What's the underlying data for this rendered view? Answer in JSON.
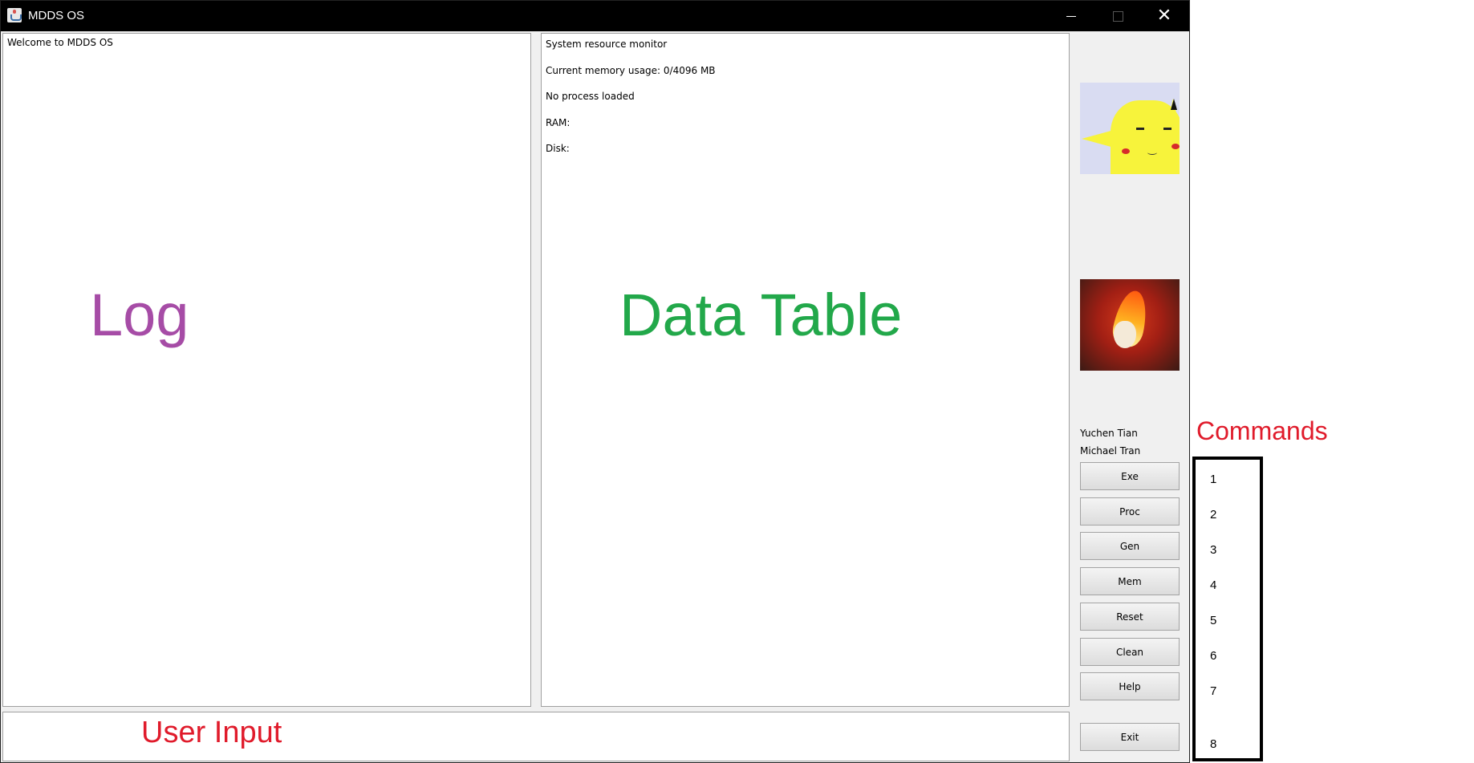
{
  "window": {
    "title": "MDDS OS",
    "icon": "java-cup-icon",
    "controls": [
      "minimize-icon",
      "maximize-icon",
      "close-icon"
    ]
  },
  "log": {
    "text": "Welcome to MDDS OS",
    "overlay_label": "Log"
  },
  "data_table": {
    "lines": [
      "System resource monitor",
      "Current memory usage: 0/4096 MB",
      "No process loaded",
      "RAM:",
      "Disk:"
    ],
    "overlay_label": "Data Table"
  },
  "user_input": {
    "value": "",
    "overlay_label": "User Input"
  },
  "sidebar": {
    "images": [
      "pikachu-image",
      "fire-character-image"
    ],
    "credits": [
      "Yuchen Tian",
      "Michael Tran"
    ],
    "buttons": [
      "Exe",
      "Proc",
      "Gen",
      "Mem",
      "Reset",
      "Clean",
      "Help",
      "Exit"
    ]
  },
  "commands_annotation": {
    "label": "Commands",
    "numbers": [
      "1",
      "2",
      "3",
      "4",
      "5",
      "6",
      "7",
      "8"
    ]
  },
  "colors": {
    "titlebar": "#000000",
    "log_label": "#a64ca6",
    "data_table_label": "#22a84a",
    "annotation_red": "#e01b2b"
  }
}
